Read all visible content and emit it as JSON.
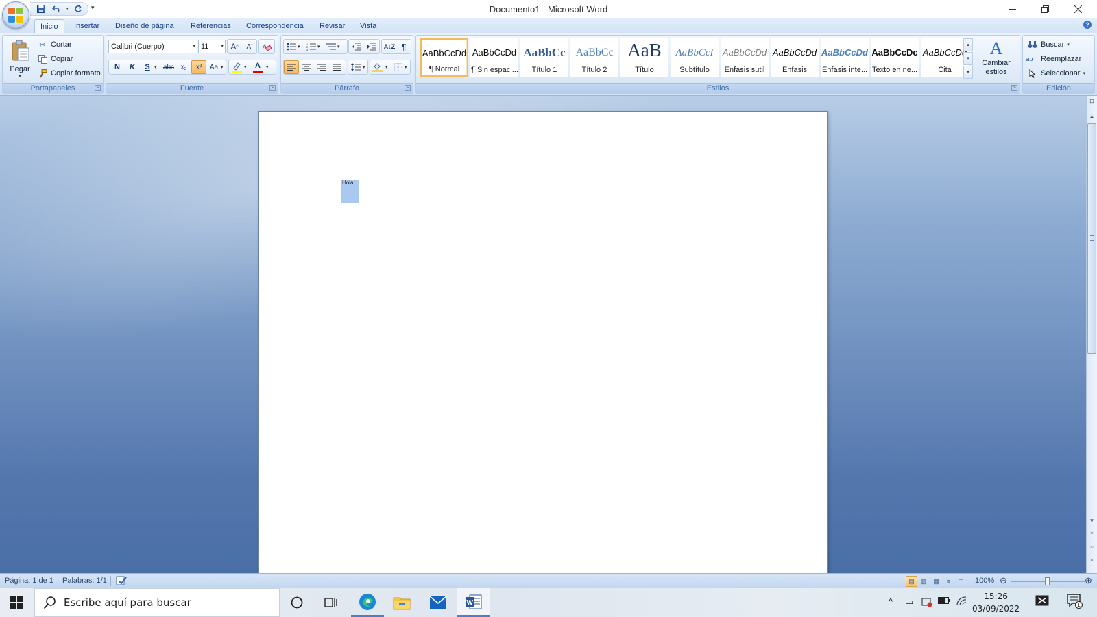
{
  "window": {
    "title": "Documento1 - Microsoft Word",
    "minimize_icon": "minimize-icon",
    "restore_icon": "restore-icon",
    "close_icon": "close-icon"
  },
  "qat": {
    "items": [
      "save-icon",
      "undo-icon",
      "redo-icon"
    ],
    "customize_icon": "dropdown-arrow-icon"
  },
  "tabs": [
    "Inicio",
    "Insertar",
    "Diseño de página",
    "Referencias",
    "Correspondencia",
    "Revisar",
    "Vista"
  ],
  "active_tab": "Inicio",
  "clipboard": {
    "label": "Portapapeles",
    "paste": "Pegar",
    "cut": "Cortar",
    "copy": "Copiar",
    "format_painter": "Copiar formato"
  },
  "font": {
    "label": "Fuente",
    "name": "Calibri (Cuerpo)",
    "size": "11",
    "grow": "A",
    "shrink": "A",
    "bold": "N",
    "italic": "K",
    "underline": "S",
    "strike": "abc",
    "subscript": "x₂",
    "superscript": "x²",
    "case": "Aa",
    "font_color": "A",
    "highlight_color": "#ffff00",
    "font_color_value": "#e00000"
  },
  "paragraph": {
    "label": "Párrafo",
    "pilcrow": "¶"
  },
  "styles": {
    "label": "Estilos",
    "items": [
      {
        "sample": "AaBbCcDd",
        "name": "¶ Normal"
      },
      {
        "sample": "AaBbCcDd",
        "name": "¶ Sin espaci..."
      },
      {
        "sample": "AaBbCc",
        "name": "Título 1"
      },
      {
        "sample": "AaBbCc",
        "name": "Título 2"
      },
      {
        "sample": "AaB",
        "name": "Título"
      },
      {
        "sample": "AaBbCcI",
        "name": "Subtítulo"
      },
      {
        "sample": "AaBbCcDd",
        "name": "Énfasis sutil"
      },
      {
        "sample": "AaBbCcDd",
        "name": "Énfasis"
      },
      {
        "sample": "AaBbCcDd",
        "name": "Énfasis inte..."
      },
      {
        "sample": "AaBbCcDc",
        "name": "Texto en ne..."
      },
      {
        "sample": "AaBbCcDd",
        "name": "Cita"
      }
    ],
    "selected_index": 0,
    "change_styles": "Cambiar estilos"
  },
  "editing": {
    "label": "Edición",
    "find": "Buscar",
    "replace": "Reemplazar",
    "select": "Seleccionar"
  },
  "document": {
    "text": "Hola"
  },
  "status": {
    "page": "Página: 1 de 1",
    "words": "Palabras: 1/1",
    "zoom": "100%",
    "zoom_level": 1.0
  },
  "taskbar": {
    "search_placeholder": "Escribe aquí para buscar",
    "time": "15:26",
    "date": "03/09/2022",
    "notification_count": "1"
  }
}
